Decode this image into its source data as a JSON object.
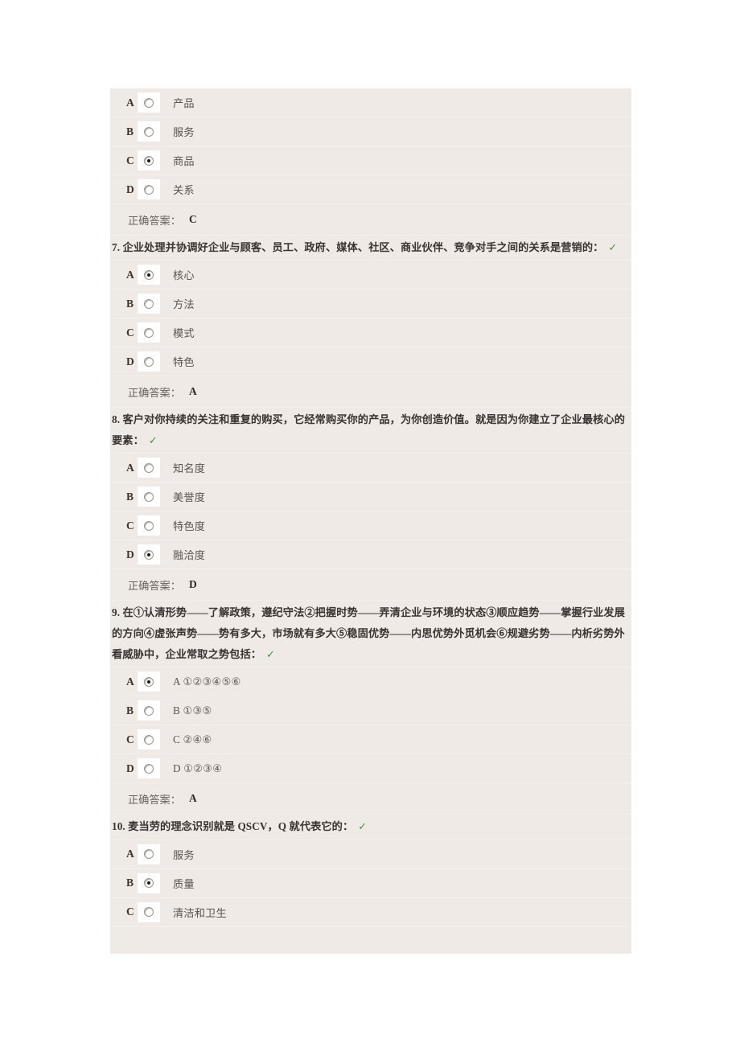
{
  "theme": {
    "page_background": "#ffffff",
    "panel_background": "#efeae6",
    "row_divider": "#f4f0ed",
    "stem_color": "#3a3431",
    "option_text_color": "#5b5450",
    "answer_value_color": "#2f2a27",
    "check_color": "#3f9443"
  },
  "labels": {
    "answer_prefix": "正确答案：",
    "check_mark": "✓"
  },
  "questions": [
    {
      "number": "",
      "stem": "",
      "stem_lines": [],
      "has_check": false,
      "options": [
        {
          "letter": "A",
          "text": "产品",
          "selected": false
        },
        {
          "letter": "B",
          "text": "服务",
          "selected": false
        },
        {
          "letter": "C",
          "text": "商品",
          "selected": true
        },
        {
          "letter": "D",
          "text": "关系",
          "selected": false
        }
      ],
      "answer": "C"
    },
    {
      "number": "7.",
      "stem": "7. 企业处理并协调好企业与顾客、员工、政府、媒体、社区、商业伙伴、竞争对手之间的关系是营销的：",
      "stem_lines": [
        "7. 企业处理并协调好企业与顾客、员工、政府、媒体、社区、商业伙伴、竞争对手之间的关系是营销的："
      ],
      "has_check": true,
      "options": [
        {
          "letter": "A",
          "text": "核心",
          "selected": true
        },
        {
          "letter": "B",
          "text": "方法",
          "selected": false
        },
        {
          "letter": "C",
          "text": "模式",
          "selected": false
        },
        {
          "letter": "D",
          "text": "特色",
          "selected": false
        }
      ],
      "answer": "A"
    },
    {
      "number": "8.",
      "stem": "8. 客户对你持续的关注和重复的购买，它经常购买你的产品，为你创造价值。就是因为你建立了企业最核心的要素：",
      "stem_lines": [
        "8. 客户对你持续的关注和重复的购买，它经常购买你的产品，为你创造价值。就是因为你建立了企业最核心的要素："
      ],
      "has_check": true,
      "options": [
        {
          "letter": "A",
          "text": "知名度",
          "selected": false
        },
        {
          "letter": "B",
          "text": "美誉度",
          "selected": false
        },
        {
          "letter": "C",
          "text": "特色度",
          "selected": false
        },
        {
          "letter": "D",
          "text": "融洽度",
          "selected": true
        }
      ],
      "answer": "D"
    },
    {
      "number": "9.",
      "stem": "9. 在①认清形势——了解政策，遵纪守法②把握时势——弄清企业与环境的状态③顺应趋势——掌握行业发展的方向④虚张声势——势有多大，市场就有多大⑤稳固优势——内思优势外觅机会⑥规避劣势——内析劣势外看威胁中，企业常取之势包括：",
      "stem_lines": [
        "9. 在①认清形势——了解政策，遵纪守法②把握时势——弄清企业与环境的状态③顺应趋势——掌握行业发展的方向④虚张声势——势有多大，市场就有多大⑤稳固优势——内思优势外觅机会⑥规避劣势——内析劣势外看威胁中，企业常取之势包括："
      ],
      "has_check": true,
      "options": [
        {
          "letter": "A",
          "text": "A ①②③④⑤⑥",
          "selected": true
        },
        {
          "letter": "B",
          "text": "B ①③⑤",
          "selected": false
        },
        {
          "letter": "C",
          "text": "C ②④⑥",
          "selected": false
        },
        {
          "letter": "D",
          "text": "D ①②③④",
          "selected": false
        }
      ],
      "answer": "A"
    },
    {
      "number": "10.",
      "stem": "10. 麦当劳的理念识别就是 QSCV，Q 就代表它的：",
      "stem_lines": [
        "10. 麦当劳的理念识别就是 QSCV，Q 就代表它的："
      ],
      "has_check": true,
      "options": [
        {
          "letter": "A",
          "text": "服务",
          "selected": false
        },
        {
          "letter": "B",
          "text": "质量",
          "selected": true
        },
        {
          "letter": "C",
          "text": "清洁和卫生",
          "selected": false
        }
      ],
      "answer": ""
    }
  ]
}
